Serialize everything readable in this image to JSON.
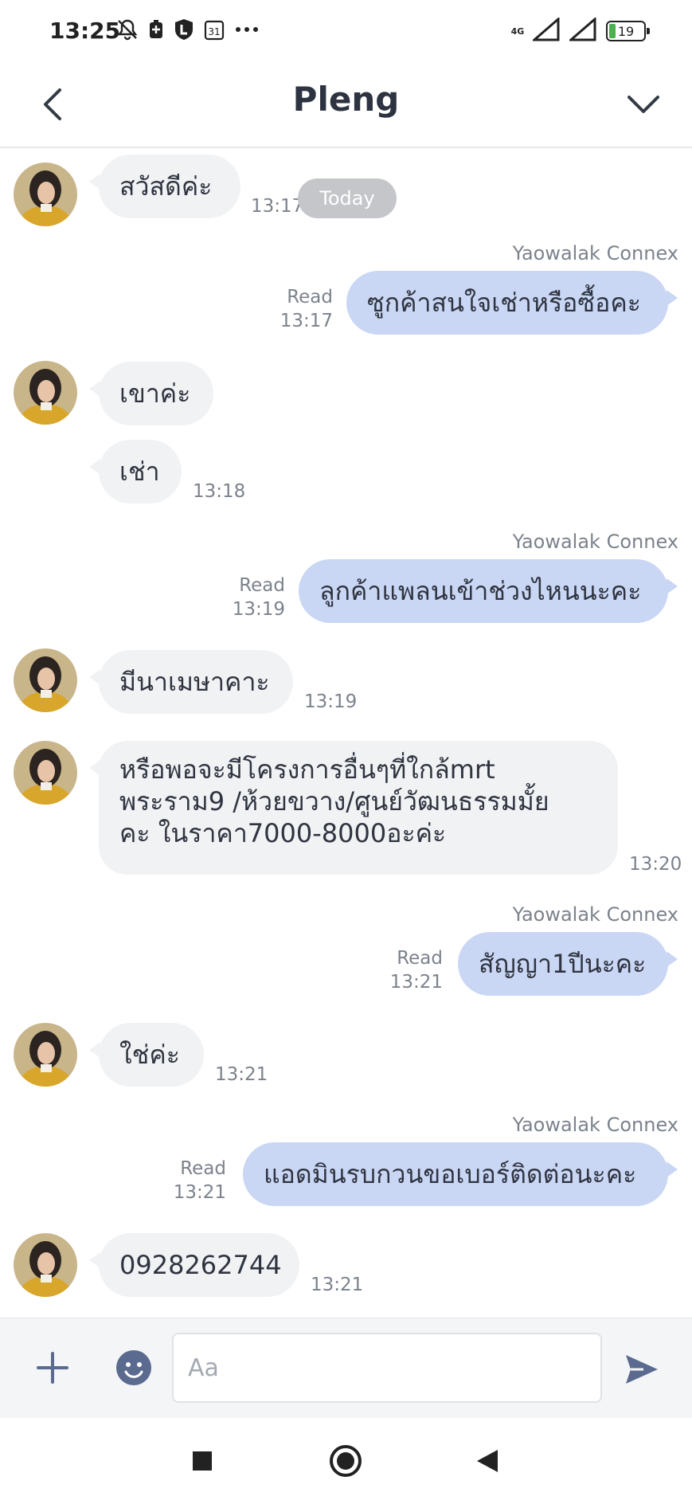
{
  "status_bar": {
    "time": "13:25",
    "network": "4G",
    "battery": "19"
  },
  "header": {
    "title": "Pleng"
  },
  "messages": [
    {
      "dir": "in",
      "text": "สวัสดีค่ะ",
      "time": "13:17"
    },
    {
      "dir": "divider",
      "text": "Today"
    },
    {
      "dir": "out",
      "sender": "Yaowalak Connex",
      "read": "Read",
      "text": "ซูกค้าสนใจเช่าหรือซื้อคะ",
      "time": "13:17"
    },
    {
      "dir": "in",
      "text": "เขาค่ะ"
    },
    {
      "dir": "in",
      "text": "เช่า",
      "time": "13:18"
    },
    {
      "dir": "out",
      "sender": "Yaowalak Connex",
      "read": "Read",
      "text": "ลูกค้าแพลนเข้าช่วงไหนนะคะ",
      "time": "13:19"
    },
    {
      "dir": "in",
      "text": "มีนาเมษาคาะ",
      "time": "13:19"
    },
    {
      "dir": "in",
      "lines": [
        "หรือพอจะมีโครงการอื่นๆที่ใกล้mrt",
        "พระราม9 /ห้วยขวาง/ศูนย์วัฒนธรรมมั้ย",
        "คะ ในราคา7000-8000อะค่ะ"
      ],
      "time": "13:20"
    },
    {
      "dir": "out",
      "sender": "Yaowalak Connex",
      "read": "Read",
      "text": "สัญญา1ปีนะคะ",
      "time": "13:21"
    },
    {
      "dir": "in",
      "text": "ใช่ค่ะ",
      "time": "13:21"
    },
    {
      "dir": "out",
      "sender": "Yaowalak Connex",
      "read": "Read",
      "text": "แอดมินรบกวนขอเบอร์ติดต่อนะคะ",
      "time": "13:21"
    },
    {
      "dir": "in",
      "text": "0928262744",
      "time": "13:21"
    }
  ],
  "input": {
    "placeholder": "Aa",
    "value": ""
  },
  "colors": {
    "outgoing_bubble": "#c9d6f4",
    "incoming_bubble": "#f1f2f4",
    "accent": "#5b6b8f"
  }
}
